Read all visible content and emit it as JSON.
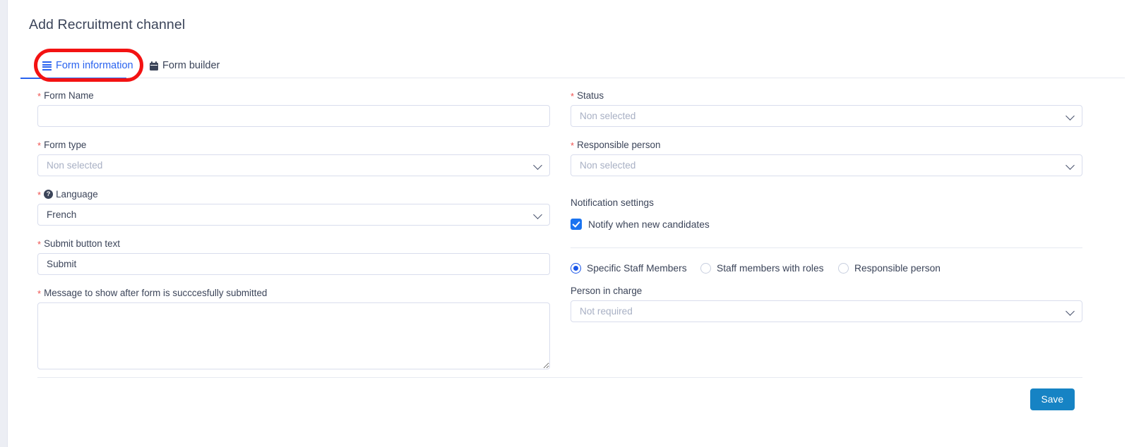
{
  "page": {
    "title": "Add Recruitment channel"
  },
  "tabs": [
    {
      "label": "Form information",
      "icon": "list-bars-icon",
      "active": true
    },
    {
      "label": "Form builder",
      "icon": "calendar-icon",
      "active": false
    }
  ],
  "left_column": {
    "form_name": {
      "label": "Form Name",
      "required_mark": "*",
      "value": "",
      "placeholder": ""
    },
    "form_type": {
      "label": "Form type",
      "required_mark": "*",
      "placeholder": "Non selected"
    },
    "language": {
      "label": "Language",
      "required_mark": "*",
      "help_icon": "question-mark-icon",
      "value": "French"
    },
    "submit_button_text": {
      "label": "Submit button text",
      "required_mark": "*",
      "value": "Submit"
    },
    "success_message": {
      "label": "Message to show after form is succcesfully submitted",
      "required_mark": "*",
      "value": "",
      "placeholder": ""
    }
  },
  "right_column": {
    "status": {
      "label": "Status",
      "required_mark": "*",
      "placeholder": "Non selected"
    },
    "responsible_person": {
      "label": "Responsible person",
      "required_mark": "*",
      "placeholder": "Non selected"
    },
    "notification_settings": {
      "heading": "Notification settings",
      "notify_checkbox": {
        "label": "Notify when new candidates",
        "checked": true
      },
      "recipient_options": [
        {
          "label": "Specific Staff Members",
          "selected": true
        },
        {
          "label": "Staff members with roles",
          "selected": false
        },
        {
          "label": "Responsible person",
          "selected": false
        }
      ],
      "person_in_charge": {
        "label": "Person in charge",
        "placeholder": "Not required"
      }
    }
  },
  "footer": {
    "save_label": "Save"
  },
  "colors": {
    "accent_blue": "#2962ef",
    "save_button": "#1683c4",
    "required_red": "#ef5350",
    "annotation_red": "#f31212",
    "text_dark": "#3b4459",
    "placeholder": "#a8b0c4",
    "border": "#d9dded"
  }
}
